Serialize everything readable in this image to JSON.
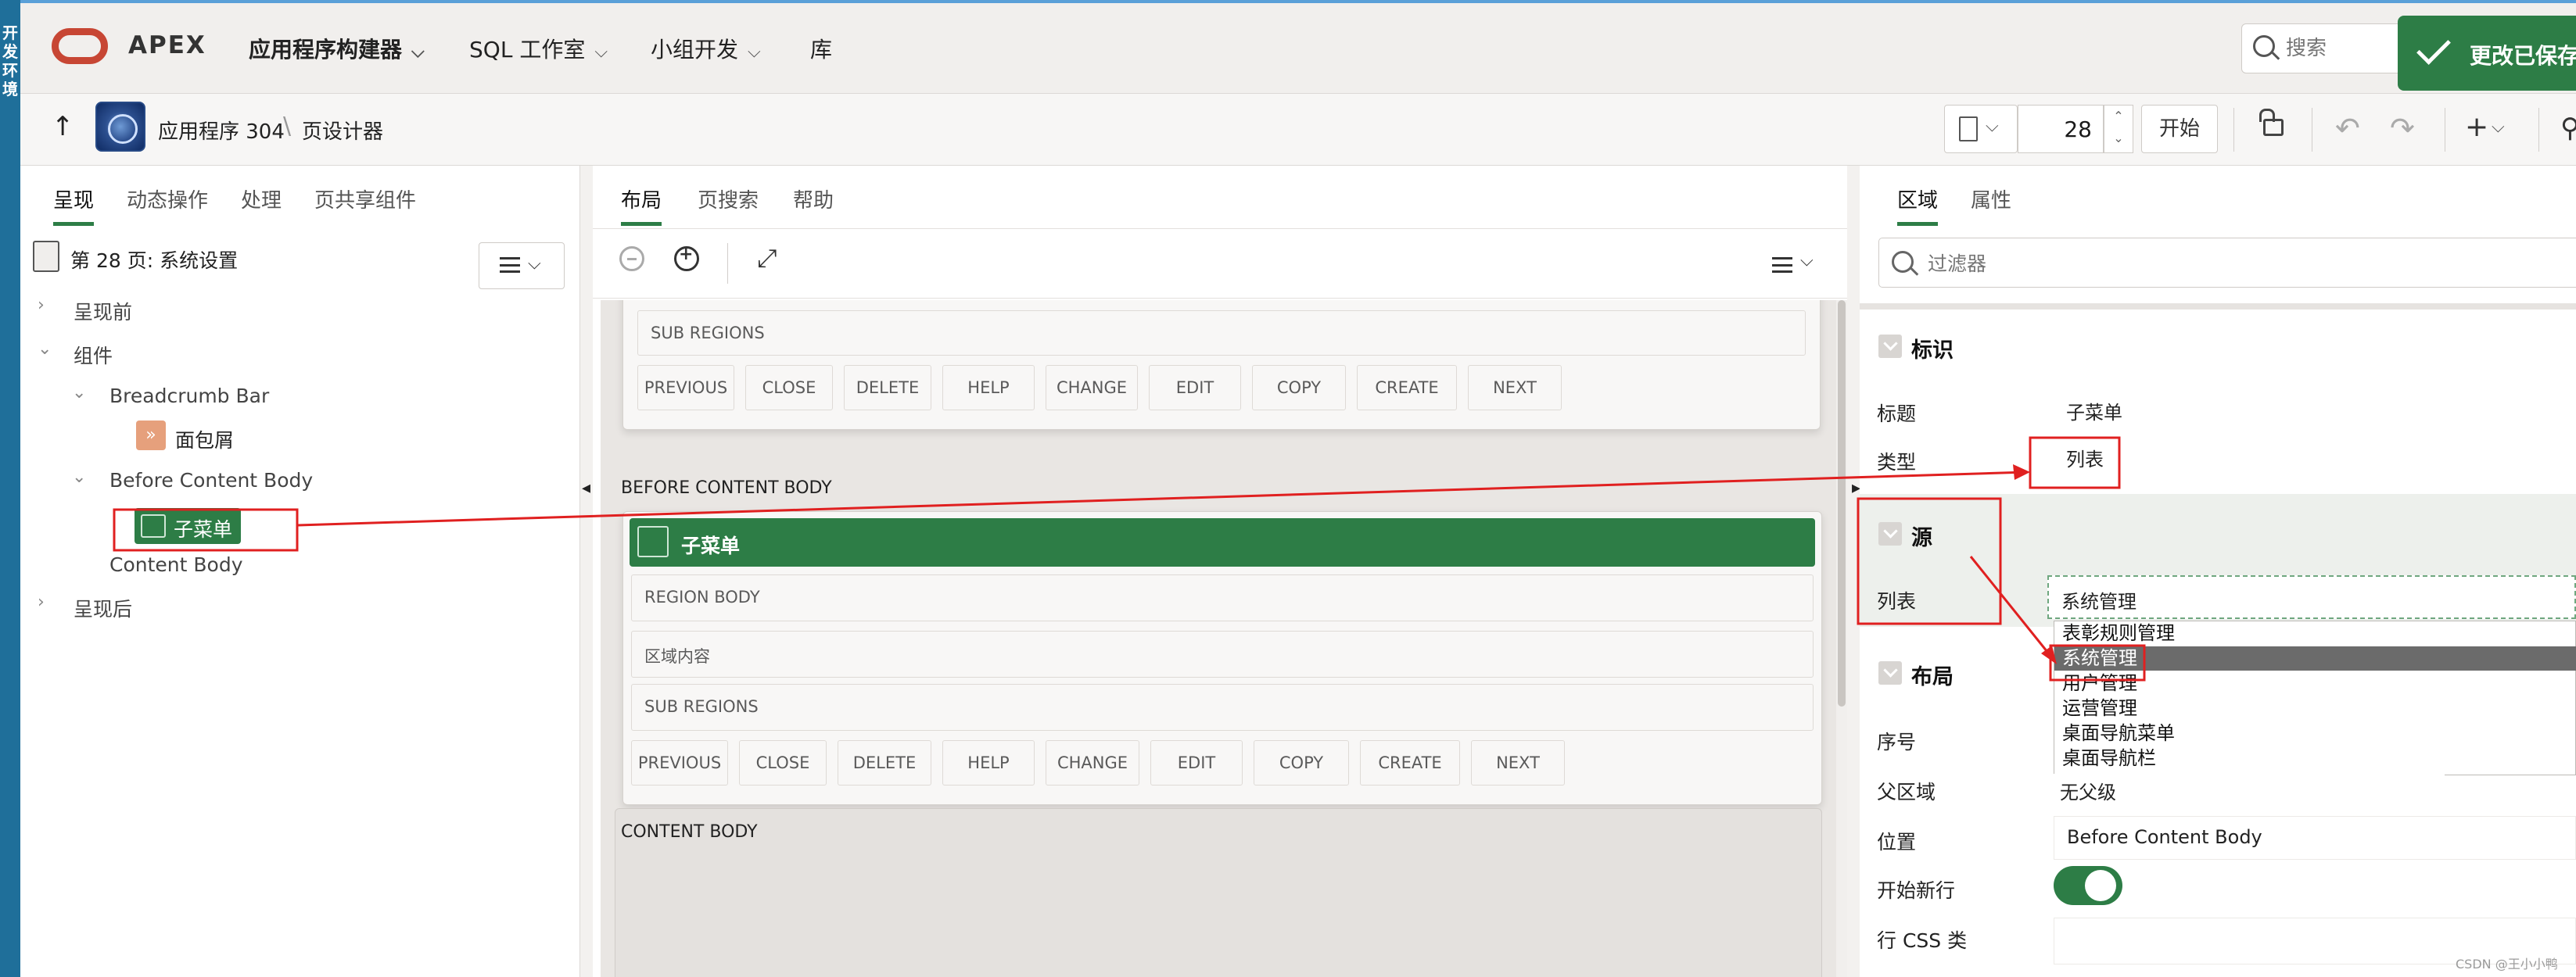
{
  "env": {
    "label": "开发环境"
  },
  "topnav": {
    "brand": "APEX",
    "items": [
      {
        "label": "应用程序构建器",
        "has_menu": true
      },
      {
        "label": "SQL 工作室",
        "has_menu": true
      },
      {
        "label": "小组开发",
        "has_menu": true
      },
      {
        "label": "库",
        "has_menu": false
      }
    ],
    "search_placeholder": "搜索",
    "toast": "更改已保存"
  },
  "toolbar": {
    "app_crumb": "应用程序 304",
    "page_crumb": "页设计器",
    "page_number": "28",
    "go_label": "开始"
  },
  "left": {
    "tabs": [
      "呈现",
      "动态操作",
      "处理",
      "页共享组件"
    ],
    "active_tab": "呈现",
    "tree_title": "第 28 页: 系统设置",
    "nodes": {
      "pre": "呈现前",
      "components": "组件",
      "breadcrumb_bar": "Breadcrumb Bar",
      "breadcrumb": "面包屑",
      "before_content": "Before Content Body",
      "submenu": "子菜单",
      "content_body": "Content Body",
      "post": "呈现后"
    }
  },
  "middle": {
    "tabs": [
      "布局",
      "页搜索",
      "帮助"
    ],
    "active_tab": "布局",
    "slots": {
      "sub_regions": "SUB REGIONS",
      "region_body": "REGION BODY",
      "region_content": "区域内容"
    },
    "buttons": [
      "PREVIOUS",
      "CLOSE",
      "DELETE",
      "HELP",
      "CHANGE",
      "EDIT",
      "COPY",
      "CREATE",
      "NEXT"
    ],
    "before_content_label": "BEFORE CONTENT BODY",
    "region_title": "子菜单",
    "content_body_label": "CONTENT BODY"
  },
  "right": {
    "tabs": [
      "区域",
      "属性"
    ],
    "active_tab": "区域",
    "filter_placeholder": "过滤器",
    "sections": {
      "identification": "标识",
      "source": "源",
      "layout": "布局"
    },
    "props": {
      "title_label": "标题",
      "title_value": "子菜单",
      "type_label": "类型",
      "type_value": "列表",
      "list_label": "列表",
      "list_value": "系统管理",
      "seq_label": "序号",
      "parent_label": "父区域",
      "parent_value": "无父级",
      "pos_label": "位置",
      "pos_value": "Before Content Body",
      "newrow_label": "开始新行",
      "rowcss_label": "行 CSS 类"
    },
    "dropdown_options": [
      "表彰规则管理",
      "系统管理",
      "用户管理",
      "运营管理",
      "桌面导航菜单",
      "桌面导航栏"
    ],
    "dropdown_selected": "系统管理"
  },
  "watermark": "CSDN @王小小鸭",
  "colors": {
    "accent": "#2d7d46",
    "oracle_red": "#c74634",
    "annotation": "#e02020",
    "env_strip": "#1f6f9a"
  }
}
